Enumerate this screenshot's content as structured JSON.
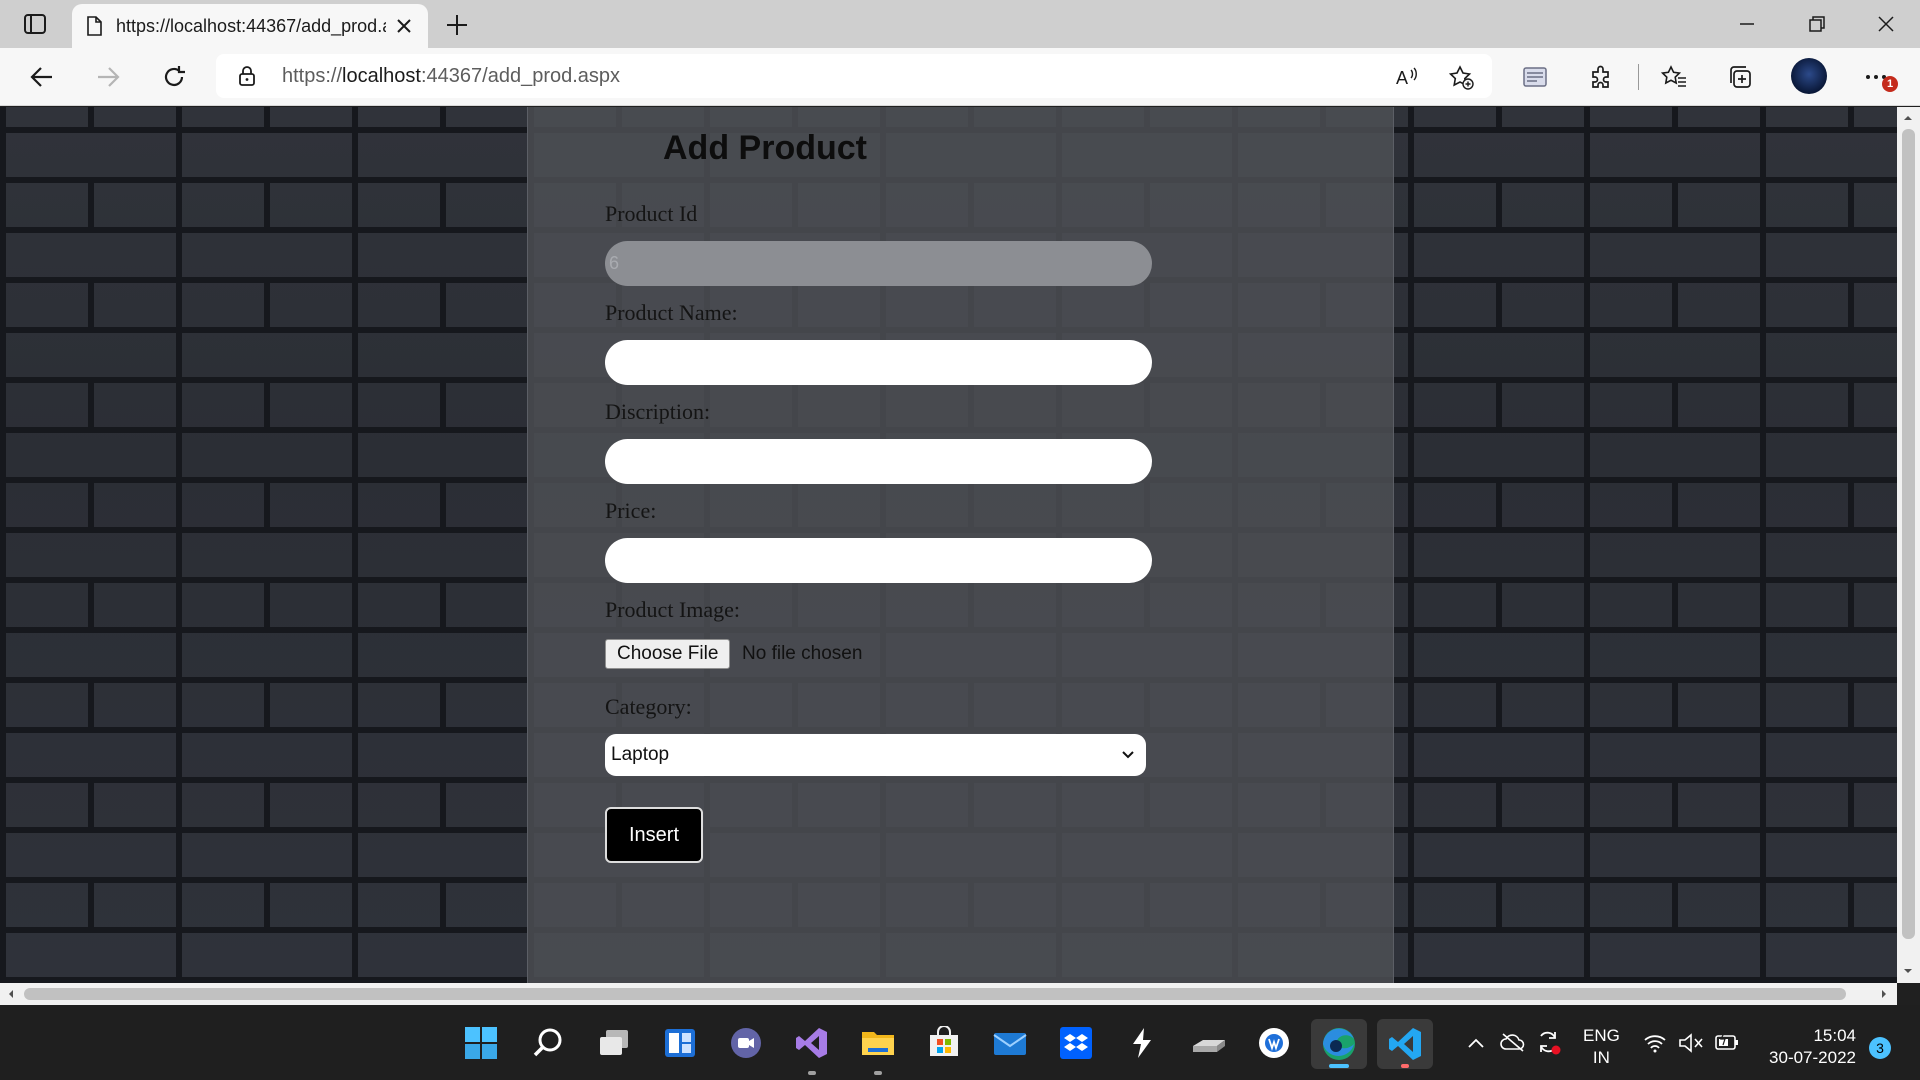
{
  "browser": {
    "tab_title": "https://localhost:44367/add_prod.aspx",
    "url_prefix": "https://",
    "url_host": "localhost",
    "url_rest": ":44367/add_prod.aspx",
    "notification_count": "1"
  },
  "form": {
    "title": "Add Product",
    "product_id_label": "Product Id",
    "product_id_value": "6",
    "product_name_label": "Product Name:",
    "product_name_value": "",
    "description_label": "Discription:",
    "description_value": "",
    "price_label": "Price:",
    "price_value": "",
    "image_label": "Product Image:",
    "choose_file_label": "Choose File",
    "no_file_text": "No file chosen",
    "category_label": "Category:",
    "category_selected": "Laptop",
    "insert_label": "Insert"
  },
  "taskbar": {
    "apps": [
      "start-icon",
      "search-icon",
      "task-view-icon",
      "widgets-icon",
      "teams-chat-icon",
      "visual-studio-icon",
      "file-explorer-icon",
      "microsoft-store-icon",
      "mail-icon",
      "dropbox-icon",
      "app-icon",
      "drive-icon",
      "app-icon",
      "edge-icon",
      "vscode-icon"
    ],
    "language_line1": "ENG",
    "language_line2": "IN",
    "time": "15:04",
    "date": "30-07-2022",
    "notification_count": "3"
  },
  "colors": {
    "accent": "#4cc2ff",
    "insert_button": "#000000",
    "panel": "#4e5056"
  }
}
